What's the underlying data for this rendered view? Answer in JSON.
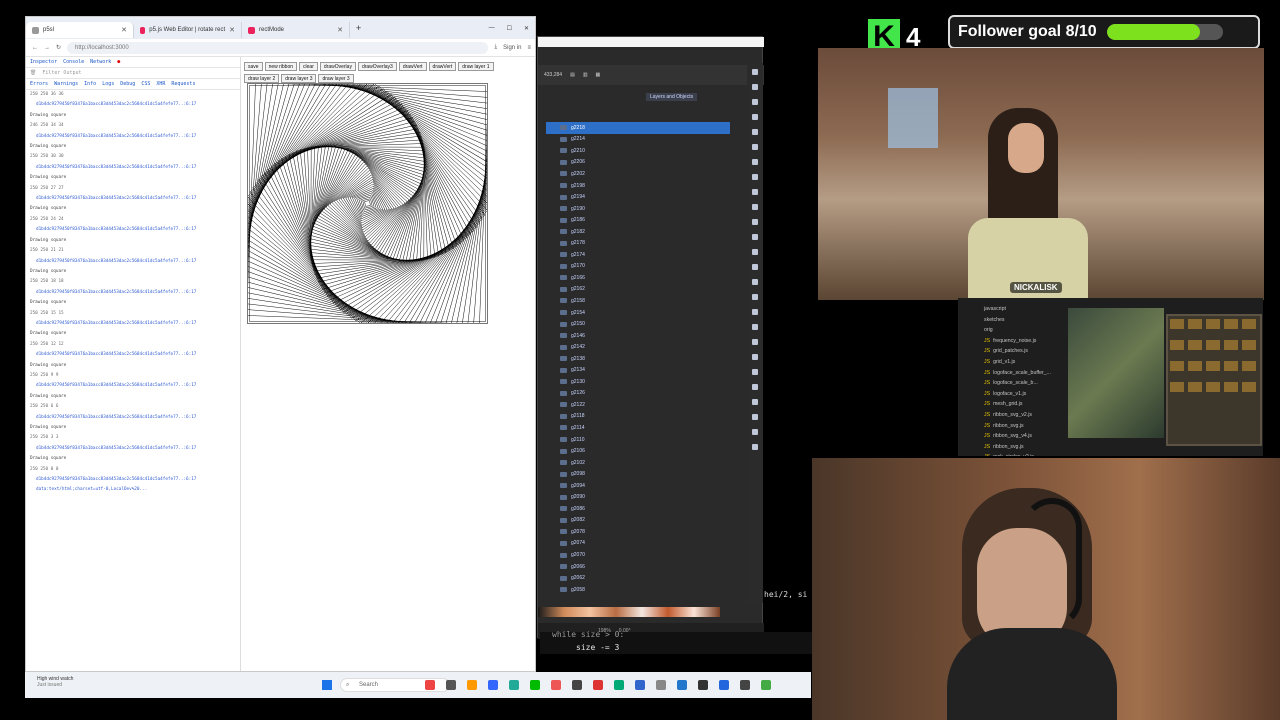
{
  "browser": {
    "tabs": [
      {
        "label": "p5sl",
        "active": true
      },
      {
        "label": "p5.js Web Editor | rotate rect",
        "active": false
      },
      {
        "label": "rectMode",
        "active": false
      }
    ],
    "url": "http://localhost:3000",
    "sign_in": "Sign in"
  },
  "devtools": {
    "tabs": [
      "Inspector",
      "Console",
      "Network"
    ],
    "filter_placeholder": "Filter Output",
    "filters": [
      "Errors",
      "Warnings",
      "Info",
      "Logs",
      "Debug",
      "CSS",
      "XHR",
      "Requests"
    ],
    "log": [
      "250 250 36 36",
      "Drawing square",
      "246 250 34 34",
      "Drawing square",
      "250 250 30 30",
      "Drawing square",
      "250 250 27 27",
      "Drawing square",
      "250 250 24 24",
      "Drawing square",
      "250 250 21 21",
      "Drawing square",
      "250 250 18 18",
      "Drawing square",
      "250 250 15 15",
      "Drawing square",
      "250 250 12 12",
      "Drawing square",
      "250 250 9 9",
      "Drawing square",
      "250 250 6 6",
      "Drawing square",
      "250 250 3 3",
      "Drawing square",
      "250 250 0 0"
    ],
    "hash_line": "d1b4dc9279450f83476a1bacc83d4453dac2c5684c41dc5a4fefe77..:6:17",
    "prompt_line": "data:text/html;charset=utf-8,LocalDev%20..."
  },
  "sketch": {
    "buttons": [
      "save",
      "new ribbon",
      "clear",
      "drawOverlay",
      "drawOverlay3",
      "drawVert",
      "drawVert",
      "draw layer 1",
      "draw layer 2",
      "draw layer 3",
      "draw layer 3"
    ]
  },
  "editor": {
    "coords": "433,284",
    "panel_title": "Layers and Objects",
    "layers": [
      "g2218",
      "g2214",
      "g2210",
      "g2206",
      "g2202",
      "g2198",
      "g2194",
      "g2190",
      "g2186",
      "g2182",
      "g2178",
      "g2174",
      "g2170",
      "g2166",
      "g2162",
      "g2158",
      "g2154",
      "g2150",
      "g2146",
      "g2142",
      "g2138",
      "g2134",
      "g2130",
      "g2126",
      "g2122",
      "g2118",
      "g2114",
      "g2110",
      "g2106",
      "g2102",
      "g2098",
      "g2094",
      "g2090",
      "g2086",
      "g2082",
      "g2078",
      "g2074",
      "g2070",
      "g2066",
      "g2062",
      "g2058"
    ],
    "zoom": "198%",
    "rotation": "0.00°"
  },
  "code": {
    "line1": "while size > 0:",
    "line2": "size -= 3",
    "side": "hei/2, si"
  },
  "stream": {
    "k_count": "4",
    "follower_label": "Follower goal 8/10",
    "follower_progress": 0.8,
    "streamer_tag": "NICKALISK",
    "accent": "#7ee11d"
  },
  "vscode_mini": {
    "files": [
      "javascript",
      "sketches",
      "orig",
      "frequency_noise.js",
      "grid_patches.js",
      "grid_v1.js",
      "logoface_scale_buffer_...",
      "logoface_scale_b...",
      "logoface_v1.js",
      "mesh_grid.js",
      "ribbon_svg_v2.js",
      "ribbon_svg.js",
      "ribbon_svg_v4.js",
      "ribbon_svg.js",
      "rock_circles_v2.js"
    ]
  },
  "taskbar": {
    "weather_line1": "High wind watch",
    "weather_line2": "Just issued",
    "search": "Search"
  }
}
